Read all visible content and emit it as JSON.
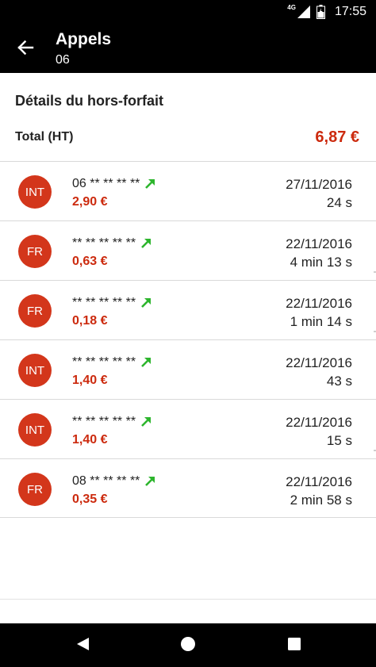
{
  "status_bar": {
    "network": "4G",
    "time": "17:55"
  },
  "app_bar": {
    "title": "Appels",
    "subtitle": "06"
  },
  "details": {
    "title": "Détails du hors-forfait",
    "total_label": "Total (HT)",
    "total_value": "6,87 €"
  },
  "calls": [
    {
      "type": "INT",
      "number": "06 ** ** ** **",
      "amount": "2,90 €",
      "date": "27/11/2016",
      "duration": "24 s"
    },
    {
      "type": "FR",
      "number": "** ** ** ** **",
      "amount": "0,63 €",
      "date": "22/11/2016",
      "duration": "4 min 13 s"
    },
    {
      "type": "FR",
      "number": "** ** ** ** **",
      "amount": "0,18 €",
      "date": "22/11/2016",
      "duration": "1 min 14 s"
    },
    {
      "type": "INT",
      "number": "** ** ** ** **",
      "amount": "1,40 €",
      "date": "22/11/2016",
      "duration": "43 s"
    },
    {
      "type": "INT",
      "number": "** ** ** ** **",
      "amount": "1,40 €",
      "date": "22/11/2016",
      "duration": "15 s"
    },
    {
      "type": "FR",
      "number": "08 ** ** ** **",
      "amount": "0,35 €",
      "date": "22/11/2016",
      "duration": "2 min 58 s"
    }
  ],
  "icons": {
    "back": "arrow-left-icon",
    "outgoing": "outgoing-call-arrow-icon",
    "nav_back": "triangle-back-icon",
    "nav_home": "circle-home-icon",
    "nav_recent": "square-recent-icon"
  },
  "colors": {
    "accent": "#cc2a0e",
    "badge": "#d3361b",
    "outgoing_arrow": "#2db52d",
    "bars": "#000000"
  }
}
